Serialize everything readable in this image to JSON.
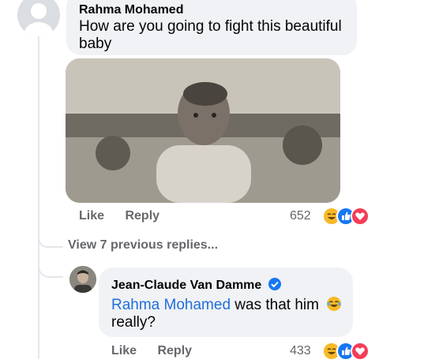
{
  "comment1": {
    "author": "Rahma Mohamed",
    "text": "How are you going to fight this beautiful baby",
    "like_label": "Like",
    "reply_label": "Reply",
    "reaction_count": "652",
    "reactions": [
      "haha-icon",
      "like-icon",
      "love-icon"
    ]
  },
  "view_previous": "View 7 previous replies...",
  "comment2": {
    "author": "Jean-Claude Van Damme",
    "mention": "Rahma Mohamed",
    "text_after_mention": " was that him",
    "text_line2": "really?",
    "like_label": "Like",
    "reply_label": "Reply",
    "reaction_count": "433",
    "reactions": [
      "haha-icon",
      "like-icon",
      "love-icon"
    ]
  },
  "colors": {
    "bubble": "#f0f2f5",
    "secondary_text": "#65676b",
    "mention": "#216fdb",
    "like_blue": "#1877f2",
    "love_red": "#f33e58",
    "haha_yellow": "#f7b928"
  }
}
